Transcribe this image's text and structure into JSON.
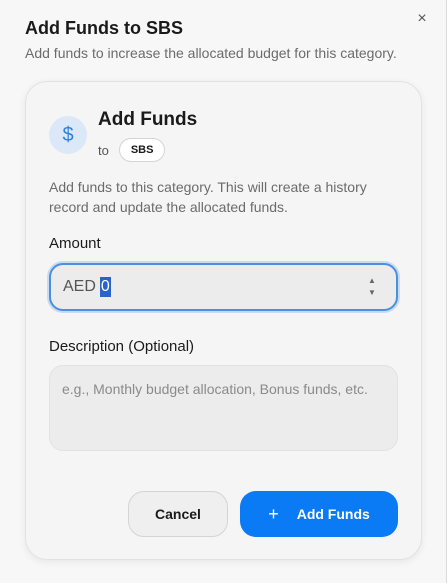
{
  "dialog": {
    "title": "Add Funds to SBS",
    "subtitle": "Add funds to increase the allocated budget for this category.",
    "close_glyph": "×"
  },
  "card": {
    "icon": "dollar-icon",
    "icon_glyph": "$",
    "title": "Add Funds",
    "to_label": "to",
    "category_chip": "SBS",
    "description": "Add funds to this category. This will create a history record and update the allocated funds."
  },
  "amount": {
    "label": "Amount",
    "currency": "AED",
    "value": "0",
    "stepper_up": "▲",
    "stepper_down": "▼"
  },
  "description_field": {
    "label": "Description (Optional)",
    "placeholder": "e.g., Monthly budget allocation, Bonus funds, etc.",
    "value": ""
  },
  "actions": {
    "cancel_label": "Cancel",
    "add_label": "Add Funds",
    "add_icon": "plus-icon",
    "add_glyph": "+"
  },
  "colors": {
    "accent": "#0a7af5",
    "focus_ring": "#4a90e2",
    "icon_bg": "#dbe8f7"
  }
}
